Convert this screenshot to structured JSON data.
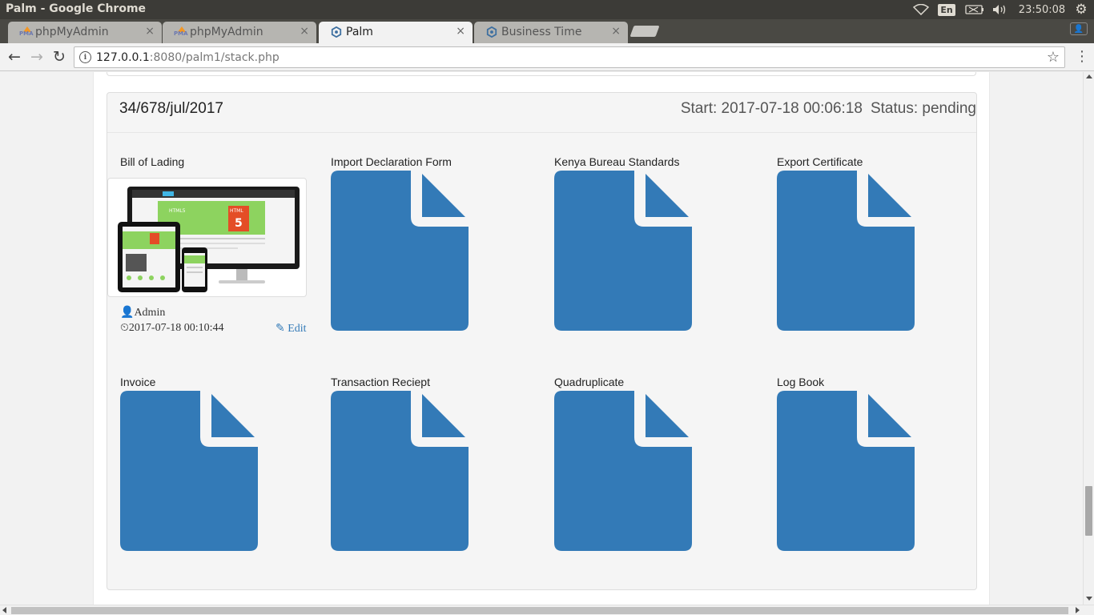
{
  "os": {
    "window_title": "Palm - Google Chrome",
    "keyboard_layout": "En",
    "clock": "23:50:08",
    "icons": [
      "wifi-icon",
      "battery-icon",
      "volume-icon",
      "gear-icon"
    ]
  },
  "browser": {
    "tabs": [
      {
        "title": "phpMyAdmin",
        "favicon": "pma",
        "favicon_text": "PMA",
        "active": false
      },
      {
        "title": "phpMyAdmin",
        "favicon": "pma",
        "favicon_text": "PMA",
        "active": false
      },
      {
        "title": "Palm",
        "favicon": "hex-logo",
        "active": true
      },
      {
        "title": "Business Time",
        "favicon": "hex-logo",
        "active": false
      }
    ],
    "tab_close_glyph": "×",
    "url_host": "127.0.0.1",
    "url_rest": ":8080/palm1/stack.php"
  },
  "stack": {
    "reference": "34/678/jul/2017",
    "start": "Start: 2017-07-18 00:06:18",
    "status": "Status: pending"
  },
  "documents": [
    {
      "label": "Bill of Lading",
      "has_preview": true
    },
    {
      "label": "Import Declaration Form",
      "has_preview": false
    },
    {
      "label": "Kenya Bureau Standards",
      "has_preview": false
    },
    {
      "label": "Export Certificate",
      "has_preview": false
    },
    {
      "label": "Invoice",
      "has_preview": false
    },
    {
      "label": "Transaction Reciept",
      "has_preview": false
    },
    {
      "label": "Quadruplicate",
      "has_preview": false
    },
    {
      "label": "Log Book",
      "has_preview": false
    }
  ],
  "preview_meta": {
    "uploader": "Admin",
    "timestamp": "2017-07-18 00:10:44",
    "edit_label": "Edit"
  },
  "preview_image_text": {
    "banner_small": "HTML5",
    "badge": "HTML",
    "badge_number": "5"
  },
  "colors": {
    "doc_icon": "#337ab7",
    "link": "#337ab7",
    "html5_green": "#8dd35f",
    "html5_orange": "#e44d26"
  }
}
